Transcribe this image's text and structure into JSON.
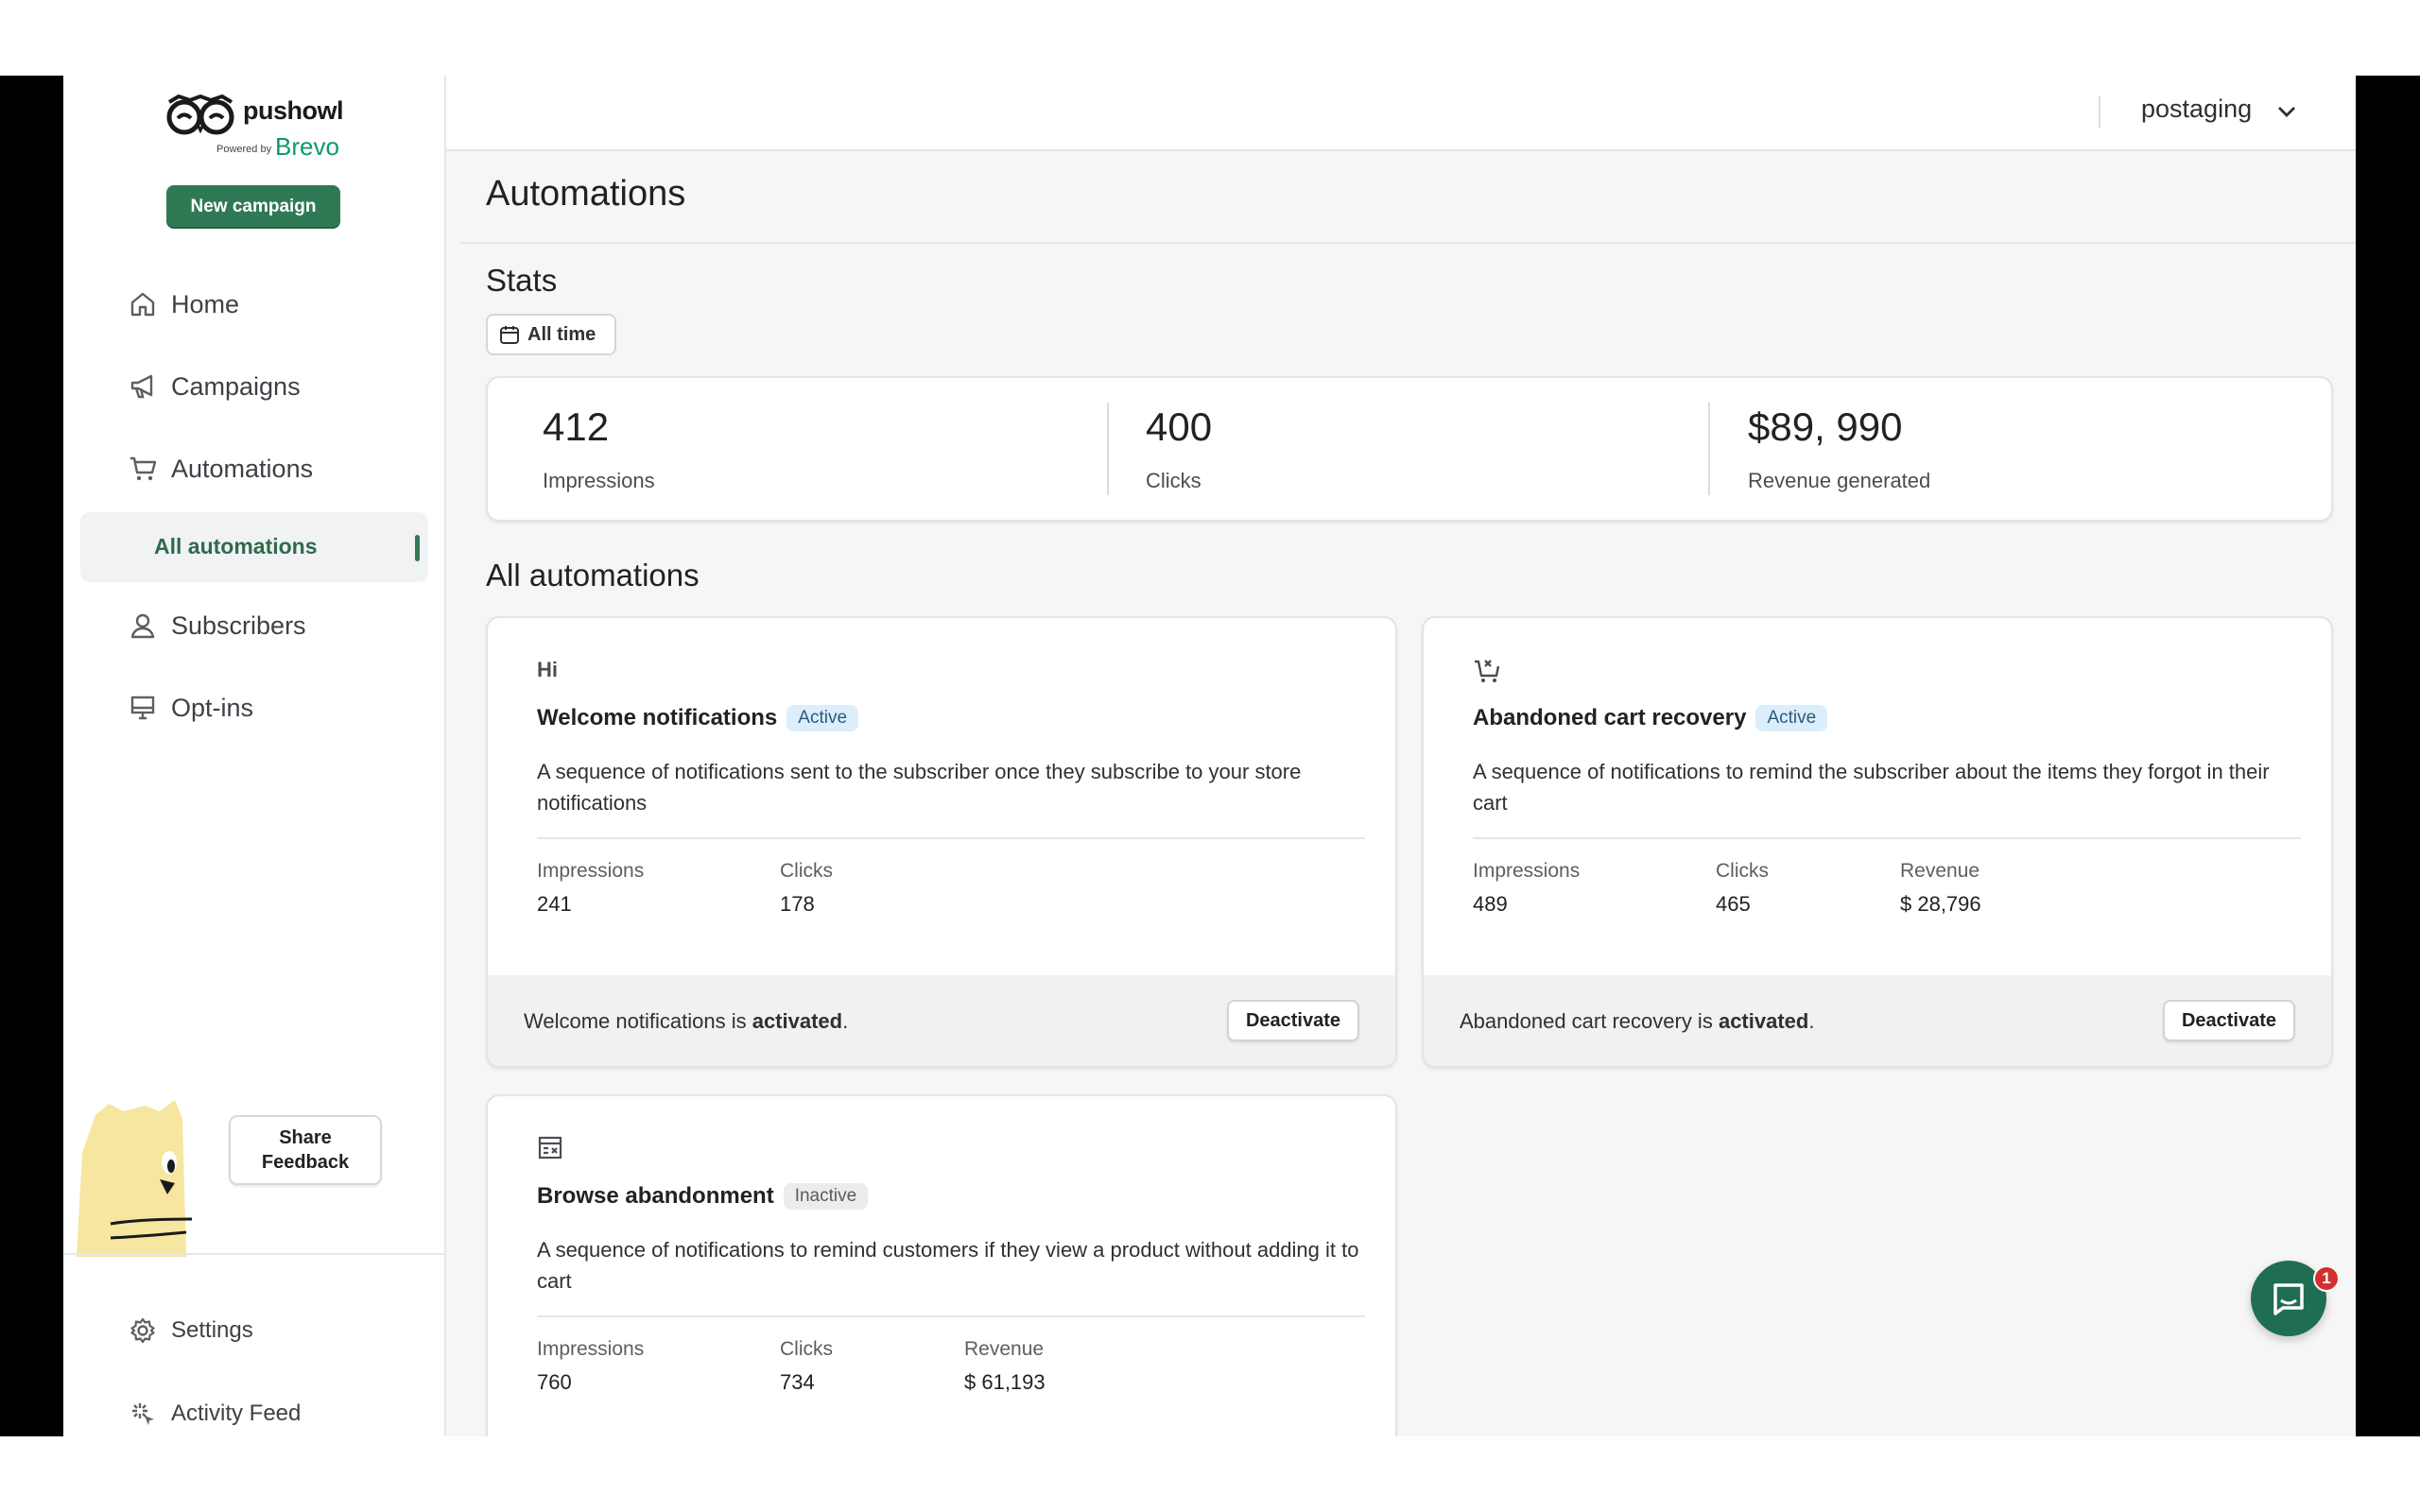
{
  "brand": {
    "name": "pushowl",
    "powered_by": "Powered by",
    "partner": "Brevo",
    "accent": "#2f7a55"
  },
  "sidebar": {
    "new_campaign_label": "New campaign",
    "items": [
      {
        "label": "Home",
        "icon": "home-icon"
      },
      {
        "label": "Campaigns",
        "icon": "megaphone-icon"
      },
      {
        "label": "Automations",
        "icon": "cart-icon"
      },
      {
        "label": "All automations",
        "icon": ""
      },
      {
        "label": "Subscribers",
        "icon": "person-icon"
      },
      {
        "label": "Opt-ins",
        "icon": "monitor-icon"
      }
    ],
    "feedback_label_line1": "Share",
    "feedback_label_line2": "Feedback",
    "bottom_items": [
      {
        "label": "Settings",
        "icon": "gear-icon"
      },
      {
        "label": "Activity Feed",
        "icon": "sparkle-icon"
      }
    ]
  },
  "topbar": {
    "store_name": "postaging"
  },
  "page": {
    "title": "Automations"
  },
  "stats": {
    "title": "Stats",
    "range_label": "All time",
    "items": [
      {
        "value": "412",
        "label": "Impressions"
      },
      {
        "value": "400",
        "label": "Clicks"
      },
      {
        "value": "$89, 990",
        "label": "Revenue generated"
      }
    ]
  },
  "automations": {
    "title": "All automations",
    "cards": [
      {
        "icon_text": "Hi",
        "title": "Welcome notifications",
        "status": "Active",
        "description": "A sequence of notifications sent to the subscriber once they subscribe to your store notifications",
        "metrics": [
          {
            "label": "Impressions",
            "value": "241"
          },
          {
            "label": "Clicks",
            "value": "178"
          }
        ],
        "footer_prefix": "Welcome notifications is",
        "footer_state": "activated",
        "footer_suffix": ".",
        "button_label": "Deactivate"
      },
      {
        "icon": "cart-remove-icon",
        "title": "Abandoned cart recovery",
        "status": "Active",
        "description": "A sequence of notifications to remind the subscriber about the items they forgot in their cart",
        "metrics": [
          {
            "label": "Impressions",
            "value": "489"
          },
          {
            "label": "Clicks",
            "value": "465"
          },
          {
            "label": "Revenue",
            "value": "$ 28,796"
          }
        ],
        "footer_prefix": "Abandoned cart recovery is",
        "footer_state": "activated",
        "footer_suffix": ".",
        "button_label": "Deactivate"
      },
      {
        "icon": "browse-icon",
        "title": "Browse abandonment",
        "status": "Inactive",
        "description": "A sequence of notifications to remind customers if they view a product without adding it to cart",
        "metrics": [
          {
            "label": "Impressions",
            "value": "760"
          },
          {
            "label": "Clicks",
            "value": "734"
          },
          {
            "label": "Revenue",
            "value": "$ 61,193"
          }
        ]
      }
    ]
  },
  "chat": {
    "unread_count": "1",
    "icon": "chat-icon"
  }
}
